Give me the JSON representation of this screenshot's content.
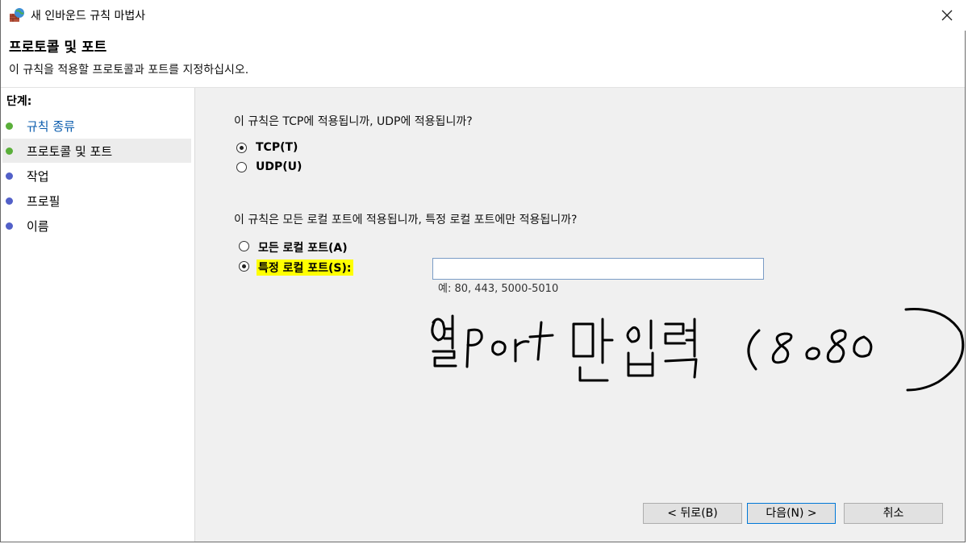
{
  "window": {
    "title": "새 인바운드 규칙 마법사"
  },
  "header": {
    "title": "프로토콜 및 포트",
    "description": "이 규칙을 적용할 프로토콜과 포트를 지정하십시오."
  },
  "sidebar": {
    "steps_label": "단계:",
    "items": [
      {
        "label": "규칙 종류",
        "status": "done",
        "color": "#5aaf3a"
      },
      {
        "label": "프로토콜 및 포트",
        "status": "current",
        "color": "#5aaf3a"
      },
      {
        "label": "작업",
        "status": "pending",
        "color": "#5260c8"
      },
      {
        "label": "프로필",
        "status": "pending",
        "color": "#5260c8"
      },
      {
        "label": "이름",
        "status": "pending",
        "color": "#5260c8"
      }
    ]
  },
  "protocol": {
    "question": "이 규칙은 TCP에 적용됩니까, UDP에 적용됩니까?",
    "options": [
      {
        "label": "TCP(T)",
        "checked": true
      },
      {
        "label": "UDP(U)",
        "checked": false
      }
    ]
  },
  "ports": {
    "question": "이 규칙은 모든 로컬 포트에 적용됩니까, 특정 로컬 포트에만 적용됩니까?",
    "options": [
      {
        "label": "모든 로컬 포트(A)",
        "checked": false
      },
      {
        "label": "특정 로컬 포트(S):",
        "checked": true,
        "highlight": "#ffff00"
      }
    ],
    "input_value": "",
    "example": "예: 80, 443, 5000-5010"
  },
  "buttons": {
    "back": "< 뒤로(B)",
    "next": "다음(N) >",
    "cancel": "취소"
  },
  "annotation": {
    "handwritten_text": "열port 만입력 (8080)"
  }
}
